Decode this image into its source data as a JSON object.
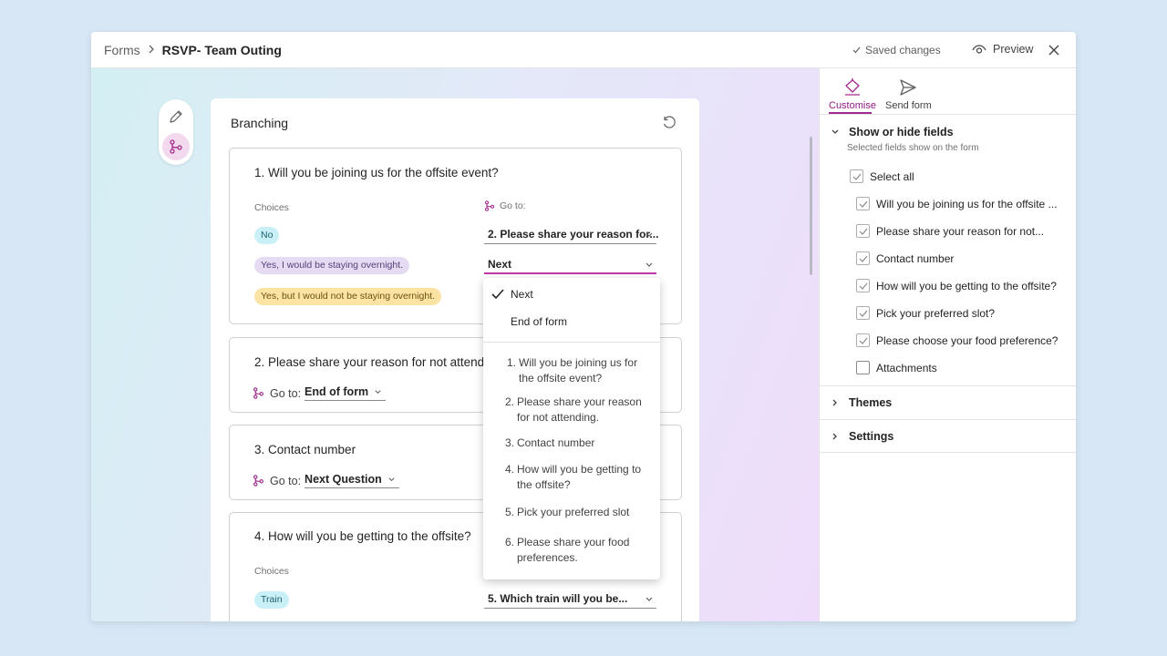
{
  "header": {
    "breadcrumb_root": "Forms",
    "breadcrumb_current": "RSVP- Team Outing",
    "saved_status": "Saved changes",
    "preview_label": "Preview"
  },
  "branching": {
    "title": "Branching",
    "q1": {
      "title": "1. Will you be joining us for the offsite event?",
      "choices_label": "Choices",
      "goto_label": "Go to:",
      "choices": [
        {
          "label": "No",
          "goto": "2. Please share your reason for..."
        },
        {
          "label": "Yes, I would be staying overnight.",
          "goto": "Next"
        },
        {
          "label": "Yes, but I would not be staying overnight."
        }
      ]
    },
    "q2": {
      "title": "2. Please share your reason for not attending.",
      "goto_label": "Go to:",
      "goto_value": "End of form"
    },
    "q3": {
      "title": "3. Contact number",
      "goto_label": "Go to:",
      "goto_value": "Next Question"
    },
    "q4": {
      "title": "4. How will you be getting to the offsite?",
      "choices_label": "Choices",
      "choices": [
        {
          "label": "Train",
          "goto": "5. Which train will you be..."
        }
      ]
    }
  },
  "dropdown": {
    "top_options": [
      "Next",
      "End of form"
    ],
    "selected": "Next",
    "questions": [
      {
        "num": "1.",
        "text": "Will you be joining us for the offsite event?"
      },
      {
        "num": "2.",
        "text": "Please share your reason for not attending."
      },
      {
        "num": "3.",
        "text": "Contact number"
      },
      {
        "num": "4.",
        "text": "How will you be getting to the offsite?"
      },
      {
        "num": "5.",
        "text": "Pick your preferred slot"
      },
      {
        "num": "6.",
        "text": "Please share your food preferences."
      }
    ]
  },
  "sidepanel": {
    "tabs": [
      {
        "label": "Customise",
        "icon": "paint-bucket-icon"
      },
      {
        "label": "Send form",
        "icon": "send-icon"
      }
    ],
    "show_hide": {
      "title": "Show or hide fields",
      "subtitle": "Selected fields show on the form",
      "select_all": "Select all",
      "fields": [
        {
          "label": "Will you be joining us for the offsite ...",
          "checked": true
        },
        {
          "label": "Please share your reason for not...",
          "checked": true
        },
        {
          "label": "Contact number",
          "checked": true
        },
        {
          "label": "How will you be getting to the offsite?",
          "checked": true
        },
        {
          "label": "Pick your preferred slot?",
          "checked": true
        },
        {
          "label": "Please choose your food preference?",
          "checked": true
        },
        {
          "label": "Attachments",
          "checked": false
        }
      ]
    },
    "themes_label": "Themes",
    "settings_label": "Settings"
  },
  "colors": {
    "accent": "#c239a6",
    "accent_dark": "#8e1a7e"
  }
}
